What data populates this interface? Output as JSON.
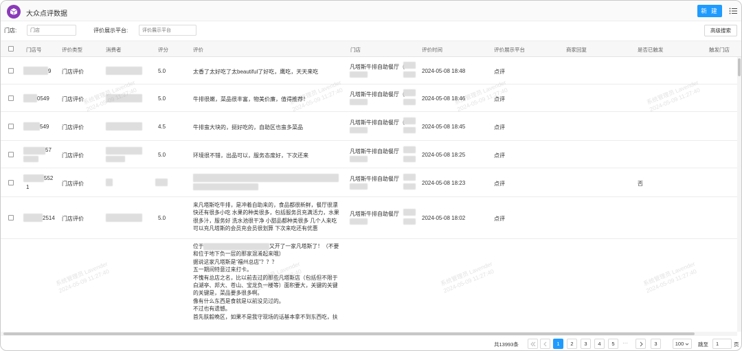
{
  "app": {
    "title": "大众点评数据",
    "new_button": "新 建"
  },
  "filter": {
    "store_label": "门店:",
    "store_placeholder": "门店",
    "platform_label": "评价展示平台:",
    "platform_placeholder": "评价展示平台",
    "advanced_button": "高级搜索"
  },
  "columns": [
    "门店号",
    "评价类型",
    "消费者",
    "评分",
    "评价",
    "门店",
    "评价时间",
    "评价展示平台",
    "商家回复",
    "是否已触发",
    "触发门店"
  ],
  "rows": [
    {
      "store_no": "9",
      "type": "门店评价",
      "score": "5.0",
      "review": "太香了太好吃了太beautiful了好吃，鹰吃，天天来吃",
      "store": "凡塔斯牛排自助餐厅（",
      "time": "2024-05-08 18:48",
      "platform": "点评",
      "triggered": ""
    },
    {
      "store_no": "0549",
      "type": "门店评价",
      "score": "5.0",
      "review": "牛排很嫩，菜品很丰富，物美价廉，值得推荐！",
      "store": "凡塔斯牛排自助餐厅（",
      "time": "2024-05-08 18:46",
      "platform": "点评",
      "triggered": ""
    },
    {
      "store_no": "549",
      "type": "门店评价",
      "score": "4.5",
      "review": "牛排蛮大块的，挺好吃的，自助区也蛮多菜品",
      "store": "凡塔斯牛排自助餐厅（",
      "time": "2024-05-08 18:45",
      "platform": "点评",
      "triggered": ""
    },
    {
      "store_no": "57",
      "type": "门店评价",
      "score": "5.0",
      "review": "环境很不错，出品可以，服务态度好，下次还来",
      "store": "凡塔斯牛排自助餐厅",
      "time": "2024-05-08 18:25",
      "platform": "点评",
      "triggered": ""
    },
    {
      "store_no": "552",
      "store_no_2": "1",
      "type": "门店评价",
      "score": "",
      "review": "",
      "store": "凡塔斯牛排自助餐厅",
      "time": "2024-05-08 18:23",
      "platform": "点评",
      "triggered": "否"
    },
    {
      "store_no": "2514",
      "type": "门店评价",
      "score": "5.0",
      "review_lines": [
        "来凡塔斯吃牛排，是冲着自助来的，食品都很新鲜，餐厅很漂",
        "快还有很多小吃 水果的种类很多，包括服务员充满活力，水果",
        "很多汁，服务好 洗水池很干净 小甜品都种类很多 几个人来吃",
        "可以充凡塔斯的会员充会员很划算 下次来吃还有优惠"
      ],
      "store": "凡塔斯牛排自助餐厅",
      "time": "2024-05-08 18:02",
      "platform": "点评",
      "triggered": ""
    }
  ],
  "long_review_lines": [
    "又开了一家凡塔斯了！（不要",
    "和位于地下负一层的那家混淆起来哦）",
    "据说这家凡塔斯是“福州总店”？？？",
    "五一期间特意过来打卡。",
    "不愧有总店之名，比以前去过的那些凡塔斯店（包括但不限于",
    "白湖亭、邦大、苍山、宝龙负一楼等）面积要大，关键的关键",
    "的关键是，菜品要多很多啊。",
    "像有什么东西是食就是以前没见过的。",
    "不过也有遗憾。",
    "首先肤毅晚区，如果不是我守现场的话基本拿不到东西吃，扶"
  ],
  "long_review_first": "位于",
  "watermark": {
    "line1": "系统管理员 Lavender",
    "line2": "2024-05-09 11:27:40"
  },
  "pager": {
    "total": "共13993条",
    "pages": [
      "1",
      "2",
      "3",
      "4",
      "5"
    ],
    "ellipsis": "···",
    "last_page": "3",
    "page_size": "100",
    "jump_label": "跳至",
    "jump_value": "1",
    "page_unit": "页"
  }
}
